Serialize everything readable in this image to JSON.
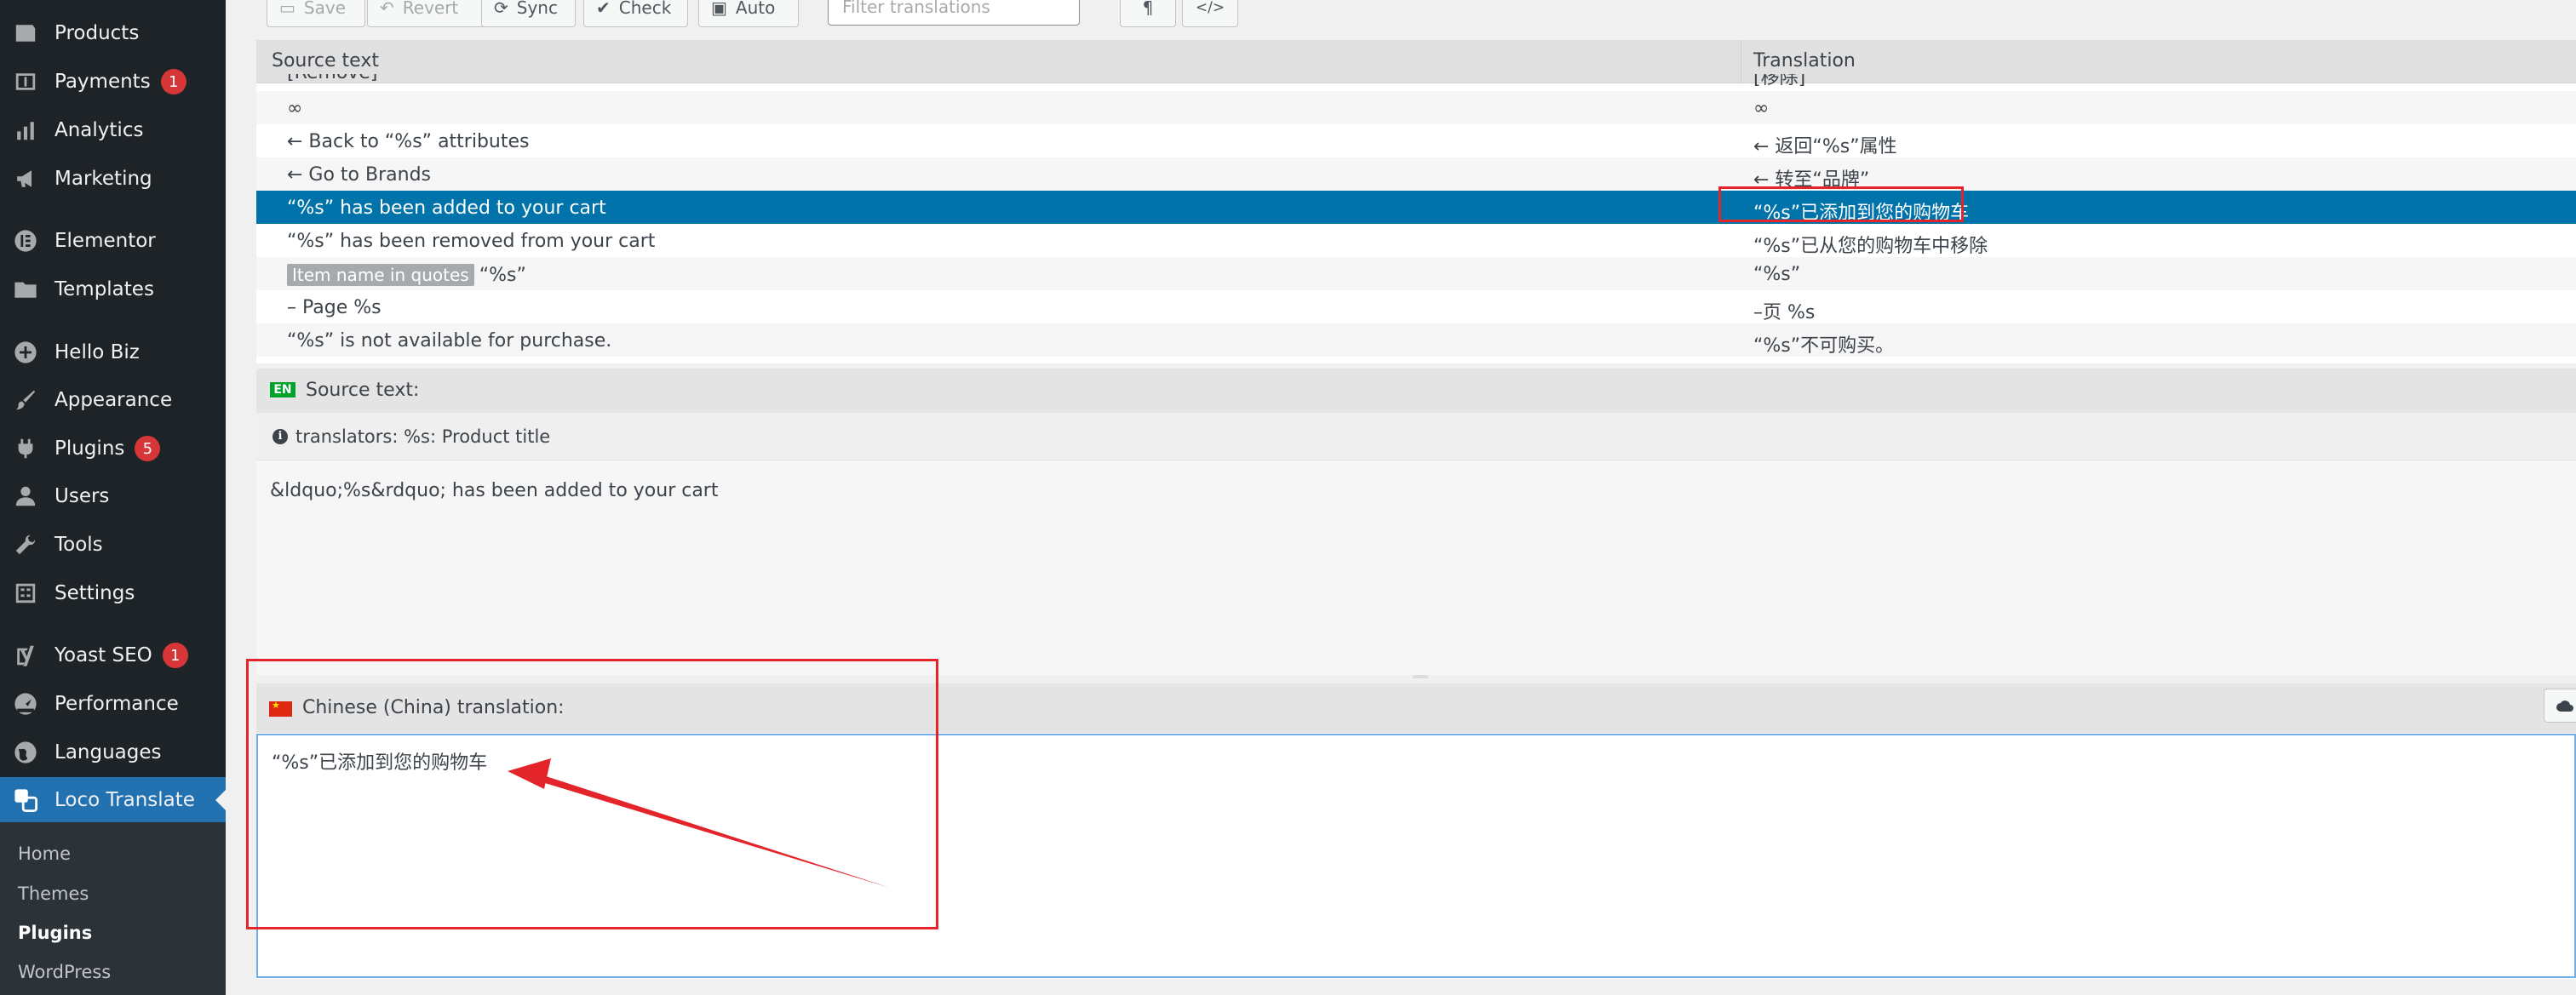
{
  "sidebar": {
    "items": [
      {
        "label": "Products",
        "icon": "products-icon"
      },
      {
        "label": "Payments",
        "icon": "payments-icon",
        "badge": "1"
      },
      {
        "label": "Analytics",
        "icon": "analytics-icon"
      },
      {
        "label": "Marketing",
        "icon": "marketing-icon"
      },
      {
        "label": "Elementor",
        "icon": "elementor-icon"
      },
      {
        "label": "Templates",
        "icon": "templates-icon"
      },
      {
        "label": "Hello Biz",
        "icon": "hello-biz-icon"
      },
      {
        "label": "Appearance",
        "icon": "appearance-icon"
      },
      {
        "label": "Plugins",
        "icon": "plugins-icon",
        "badge": "5"
      },
      {
        "label": "Users",
        "icon": "users-icon"
      },
      {
        "label": "Tools",
        "icon": "tools-icon"
      },
      {
        "label": "Settings",
        "icon": "settings-icon"
      },
      {
        "label": "Yoast SEO",
        "icon": "yoast-icon",
        "badge": "1"
      },
      {
        "label": "Performance",
        "icon": "performance-icon"
      },
      {
        "label": "Languages",
        "icon": "languages-icon"
      },
      {
        "label": "Loco Translate",
        "icon": "loco-translate-icon",
        "active": true
      }
    ],
    "submenu": [
      {
        "label": "Home"
      },
      {
        "label": "Themes"
      },
      {
        "label": "Plugins",
        "current": true
      },
      {
        "label": "WordPress"
      }
    ]
  },
  "toolbar": {
    "save": "Save",
    "revert": "Revert",
    "sync": "Sync",
    "check": "Check",
    "auto": "Auto",
    "filter_placeholder": "Filter translations",
    "pilcrow": "¶",
    "code": "</>"
  },
  "grid": {
    "col_source": "Source text",
    "col_translation": "Translation",
    "rows": [
      {
        "src": "[Remove]",
        "tr": "[移除]"
      },
      {
        "src": "∞",
        "tr": "∞"
      },
      {
        "src": "← Back to “%s” attributes",
        "tr": "← 返回“%s”属性"
      },
      {
        "src": "← Go to Brands",
        "tr": "← 转至“品牌”"
      },
      {
        "src": "“%s” has been added to your cart",
        "tr": "“%s”已添加到您的购物车"
      },
      {
        "src": "“%s” has been removed from your cart",
        "tr": "“%s”已从您的购物车中移除"
      },
      {
        "tag": "Item name in quotes",
        "src": "“%s”",
        "tr": "“%s”"
      },
      {
        "src": "– Page %s",
        "tr": "–页 %s"
      },
      {
        "src": "“%s” is not available for purchase.",
        "tr": "“%s”不可购买。"
      }
    ]
  },
  "source_panel": {
    "lang_code": "EN",
    "title": "Source text:",
    "note": "translators: %s: Product title",
    "text": "&ldquo;%s&rdquo; has been added to your cart"
  },
  "translation_panel": {
    "title": "Chinese (China) translation:",
    "value": "“%s”已添加到您的购物车"
  },
  "colors": {
    "sidebar_bg": "#1d2327",
    "active": "#2271b1",
    "selected_row": "#0073aa",
    "badge": "#d63638",
    "annotation": "#e3242b"
  }
}
